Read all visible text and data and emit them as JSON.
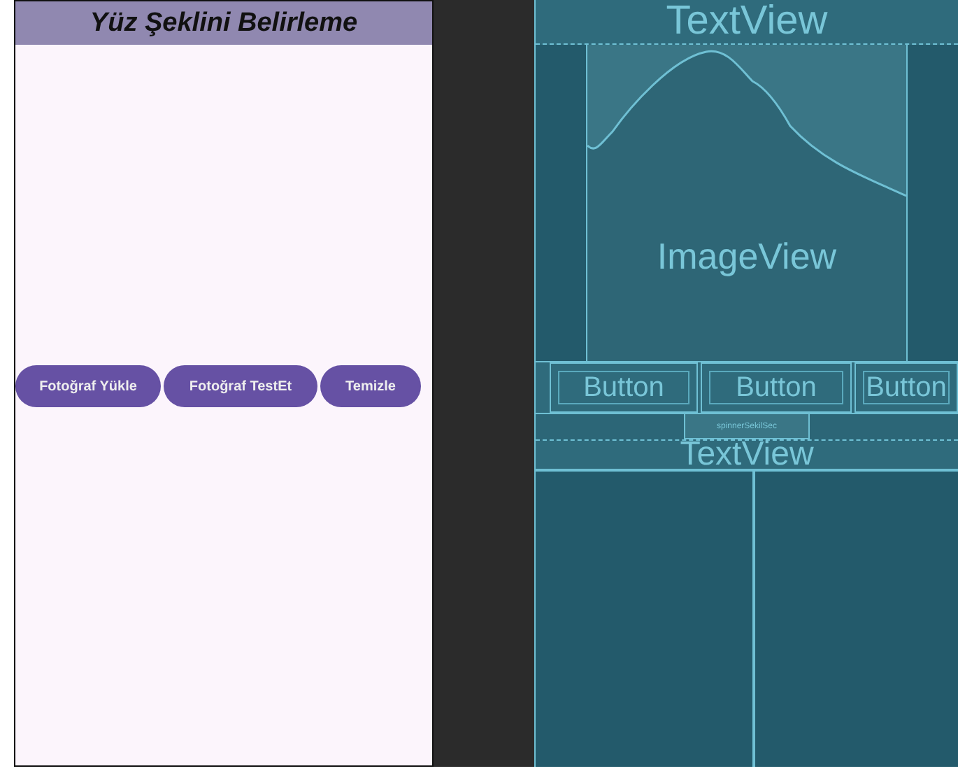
{
  "design": {
    "title": "Yüz Şeklini Belirleme",
    "buttons": [
      "Fotoğraf Yükle",
      "Fotoğraf TestEt",
      "Temizle"
    ]
  },
  "blueprint": {
    "top_text": "TextView",
    "image_label": "ImageView",
    "buttons": [
      "Button",
      "Button",
      "Button"
    ],
    "spinner": "spinnerSekilSec",
    "bottom_text": "TextView"
  }
}
